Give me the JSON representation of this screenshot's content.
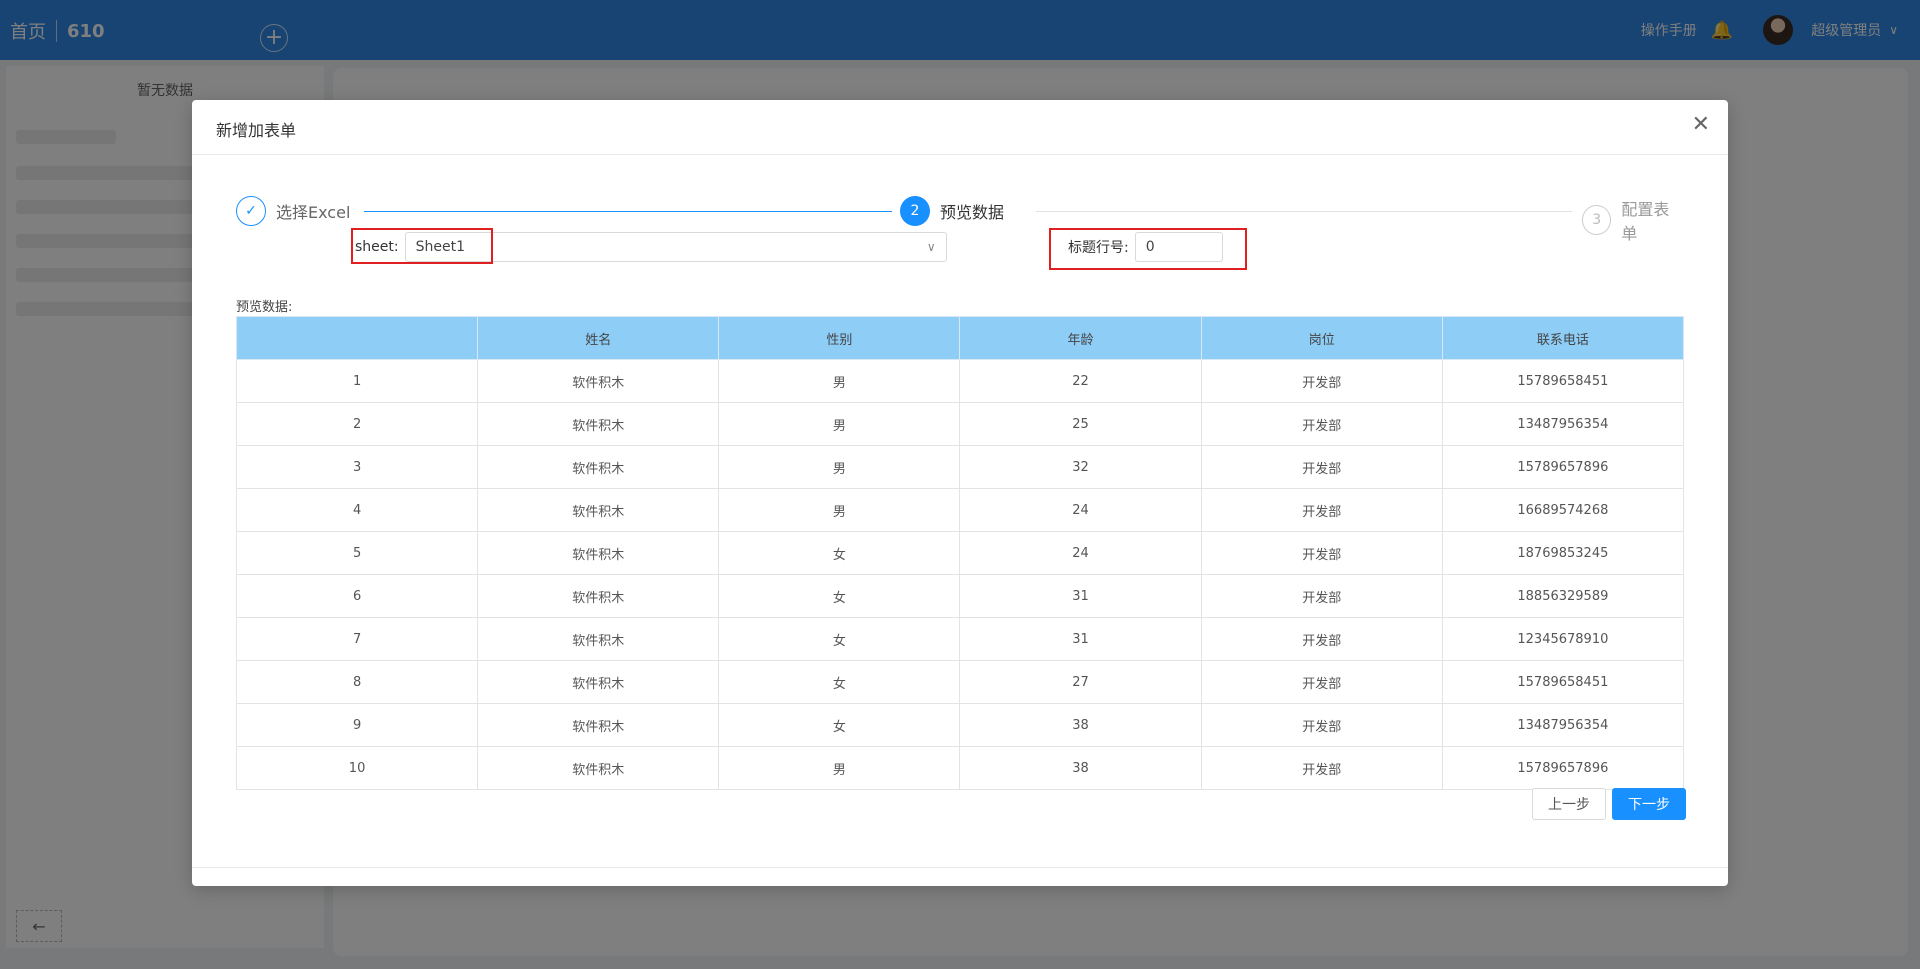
{
  "topbar": {
    "home": "首页",
    "code": "610",
    "add_icon": "plus-circle-icon",
    "manual": "操作手册",
    "user": "超级管理员"
  },
  "sidebar": {
    "empty": "暂无数据",
    "collapse_icon": "arrow-left-icon"
  },
  "modal": {
    "title": "新增加表单",
    "close_icon": "close-icon",
    "steps": [
      {
        "label": "选择Excel",
        "mark": "✓",
        "status": "finished"
      },
      {
        "label": "预览数据",
        "mark": "2",
        "status": "active"
      },
      {
        "label": "配置表单",
        "mark": "3",
        "status": "pending"
      }
    ],
    "sheet_label": "sheet:",
    "sheet_value": "Sheet1",
    "title_row_label": "标题行号:",
    "title_row_value": "0",
    "preview_label": "预览数据:",
    "prev_button": "上一步",
    "next_button": "下一步",
    "highlight_color": "#e02020",
    "accent_color": "#1890ff"
  },
  "table": {
    "headers": [
      "",
      "姓名",
      "性别",
      "年龄",
      "岗位",
      "联系电话"
    ],
    "rows": [
      [
        "1",
        "软件积木",
        "男",
        "22",
        "开发部",
        "15789658451"
      ],
      [
        "2",
        "软件积木",
        "男",
        "25",
        "开发部",
        "13487956354"
      ],
      [
        "3",
        "软件积木",
        "男",
        "32",
        "开发部",
        "15789657896"
      ],
      [
        "4",
        "软件积木",
        "男",
        "24",
        "开发部",
        "16689574268"
      ],
      [
        "5",
        "软件积木",
        "女",
        "24",
        "开发部",
        "18769853245"
      ],
      [
        "6",
        "软件积木",
        "女",
        "31",
        "开发部",
        "18856329589"
      ],
      [
        "7",
        "软件积木",
        "女",
        "31",
        "开发部",
        "12345678910"
      ],
      [
        "8",
        "软件积木",
        "女",
        "27",
        "开发部",
        "15789658451"
      ],
      [
        "9",
        "软件积木",
        "女",
        "38",
        "开发部",
        "13487956354"
      ],
      [
        "10",
        "软件积木",
        "男",
        "38",
        "开发部",
        "15789657896"
      ]
    ]
  }
}
